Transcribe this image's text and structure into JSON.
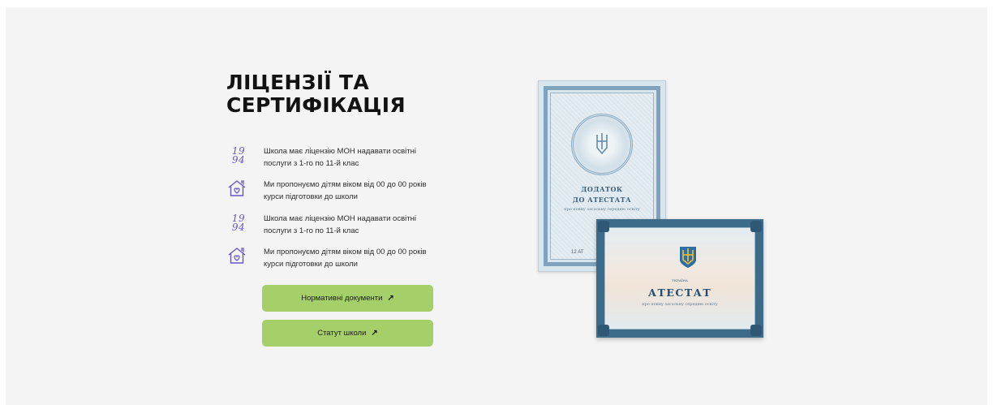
{
  "section": {
    "title": "ЛІЦЕНЗІЇ ТА СЕРТИФІКАЦІЯ"
  },
  "features": [
    {
      "icon": "year-1994-icon",
      "year_top": "19",
      "year_bottom": "94",
      "text": "Школа має ліцензію МОН надавати освітні послуги з 1-го по 11-й клас"
    },
    {
      "icon": "house-heart-icon",
      "text": "Ми пропонуємо дітям віком від 00 до 00 років курси підготовки до школи"
    },
    {
      "icon": "year-1994-icon",
      "year_top": "19",
      "year_bottom": "94",
      "text": "Школа має ліцензію МОН надавати освітні послуги з 1-го по 11-й клас"
    },
    {
      "icon": "house-heart-icon",
      "text": "Ми пропонуємо дітям віком від 00 до 00 років курси підготовки до школи"
    }
  ],
  "buttons": {
    "normative_docs": "Нормативні документи",
    "charter": "Статут школи",
    "arrow": "↗"
  },
  "certificates": {
    "back": {
      "title_line1": "ДОДАТОК",
      "title_line2": "ДО АТЕСТАТА",
      "subtitle": "про повну загальну середню освіту",
      "serial": "12 АТ"
    },
    "front": {
      "country": "УКРАЇНА",
      "title": "АТЕСТАТ",
      "subtitle": "про повну загальну середню освіту"
    }
  },
  "colors": {
    "background": "#f4f4f4",
    "accent_button": "#a5cf68",
    "icon_purple": "#6b55c8",
    "title_text": "#121212"
  }
}
